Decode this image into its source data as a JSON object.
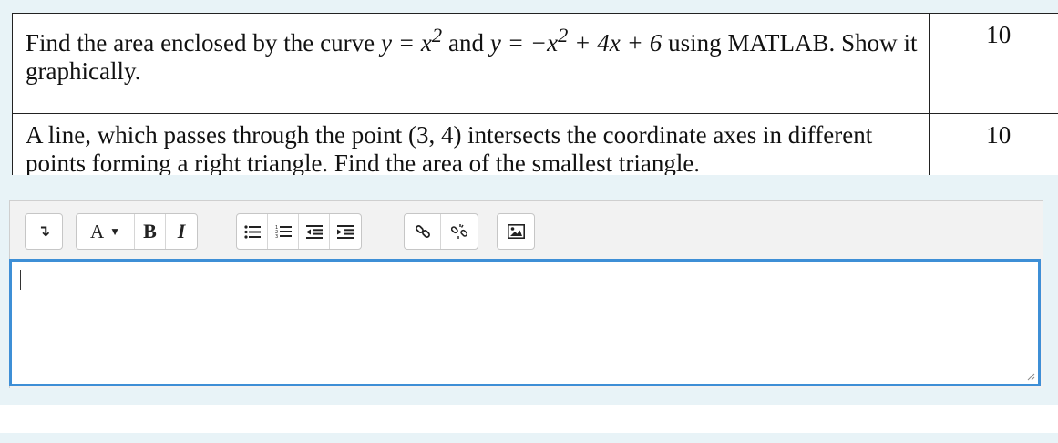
{
  "questions": [
    {
      "text_a": "Find the area enclosed by the curve ",
      "eq1": "y = x",
      "eq1_exp": "2",
      "text_b": " and  ",
      "eq2": "y = −x",
      "eq2_exp": "2",
      "eq2_rest": " + 4x + 6",
      "text_c": " using MATLAB. Show it graphically.",
      "marks": "10"
    },
    {
      "text": "A line, which passes through the point (3, 4) intersects the coordinate axes in different points forming a right triangle. Find the area of the smallest triangle.",
      "marks": "10"
    }
  ],
  "toolbar": {
    "collapse_icon": "↴",
    "font_label": "A",
    "font_caret": "▼",
    "bold_label": "B",
    "italic_label": "I",
    "icons": [
      "show-more-icon",
      "font-style-icon",
      "bold-icon",
      "italic-icon",
      "unordered-list-icon",
      "ordered-list-icon",
      "outdent-icon",
      "indent-icon",
      "link-icon",
      "unlink-icon",
      "image-icon"
    ]
  },
  "editor": {
    "value": ""
  },
  "colors": {
    "block_bg": "#e8f3f7",
    "focus_border": "#3e8fd6",
    "toolbar_bg": "#f2f2f2"
  }
}
